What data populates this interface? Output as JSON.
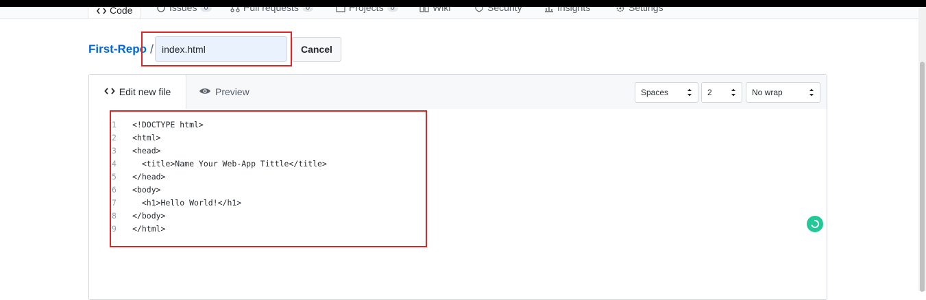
{
  "repo_nav": {
    "tabs": [
      {
        "label": "Code",
        "icon": "code-icon"
      },
      {
        "label": "Issues",
        "count": "0",
        "icon": "issue-icon"
      },
      {
        "label": "Pull requests",
        "count": "0",
        "icon": "pull-request-icon"
      },
      {
        "label": "Projects",
        "count": "0",
        "icon": "project-icon"
      },
      {
        "label": "Wiki",
        "icon": "wiki-icon"
      },
      {
        "label": "Security",
        "icon": "shield-icon"
      },
      {
        "label": "Insights",
        "icon": "graph-icon"
      },
      {
        "label": "Settings",
        "icon": "gear-icon"
      }
    ]
  },
  "breadcrumb": {
    "repo": "First-Repo",
    "separator": "/"
  },
  "filename": {
    "value": "index.html"
  },
  "buttons": {
    "cancel": "Cancel"
  },
  "editor": {
    "tabs": {
      "edit": "Edit new file",
      "preview": "Preview"
    },
    "options": {
      "indent_mode": "Spaces",
      "indent_size": "2",
      "wrap_mode": "No wrap"
    },
    "lines": [
      {
        "number": "1",
        "text": "<!DOCTYPE html>"
      },
      {
        "number": "2",
        "text": "<html>"
      },
      {
        "number": "3",
        "text": "<head>"
      },
      {
        "number": "4",
        "text": "  <title>Name Your Web-App Tittle</title>"
      },
      {
        "number": "5",
        "text": "</head>"
      },
      {
        "number": "6",
        "text": "<body>"
      },
      {
        "number": "7",
        "text": "  <h1>Hello World!</h1>"
      },
      {
        "number": "8",
        "text": "</body>"
      },
      {
        "number": "9",
        "text": "</html>"
      }
    ]
  },
  "colors": {
    "link": "#0366d6",
    "annotation": "#e02424",
    "assistant_badge": "#20c997"
  }
}
